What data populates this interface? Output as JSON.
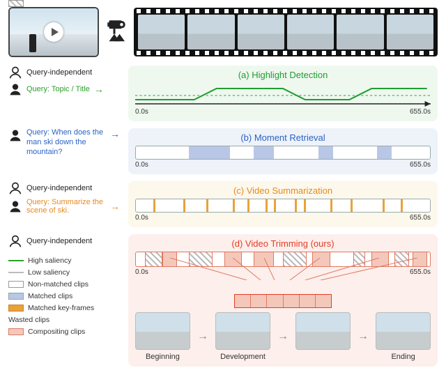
{
  "top": {
    "video_alt": "Skiing video thumbnail",
    "frames": 6
  },
  "side": {
    "query_independent": "Query-independent",
    "topic_query": "Query: Topic / Title",
    "moment_query": "Query: When does the man ski down the mountain?",
    "summarize_query": "Query: Summarize the scene of ski."
  },
  "panels": {
    "a": {
      "title": "(a) Highlight Detection",
      "t0": "0.0s",
      "t1": "655.0s"
    },
    "b": {
      "title": "(b) Moment Retrieval",
      "t0": "0.0s",
      "t1": "655.0s",
      "matched_pct": [
        [
          18,
          32
        ],
        [
          40,
          47
        ],
        [
          62,
          67
        ],
        [
          82,
          87
        ]
      ]
    },
    "c": {
      "title": "(c) Video Summarization",
      "t0": "0.0s",
      "t1": "655.0s",
      "keyframes_pct": [
        6,
        16,
        24,
        33,
        38,
        44,
        47,
        54,
        57,
        66,
        73,
        84,
        90
      ]
    },
    "d": {
      "title": "(d) Video Trimming (ours)",
      "t0": "0.0s",
      "t1": "655.0s",
      "wasted_pct": [
        [
          3,
          9
        ],
        [
          18,
          26
        ],
        [
          50,
          58
        ],
        [
          74,
          78
        ],
        [
          88,
          93
        ]
      ],
      "kept_pct": [
        [
          9,
          14
        ],
        [
          30,
          36
        ],
        [
          40,
          47
        ],
        [
          60,
          66
        ],
        [
          80,
          86
        ],
        [
          94,
          99
        ]
      ],
      "stages": [
        "Beginning",
        "Development",
        "",
        "Ending"
      ]
    }
  },
  "legend": {
    "high_saliency": "High saliency",
    "low_saliency": "Low saliency",
    "non_matched": "Non-matched clips",
    "matched": "Matched clips",
    "matched_kf": "Matched key-frames",
    "wasted": "Wasted clips",
    "compositing": "Compositing clips"
  }
}
